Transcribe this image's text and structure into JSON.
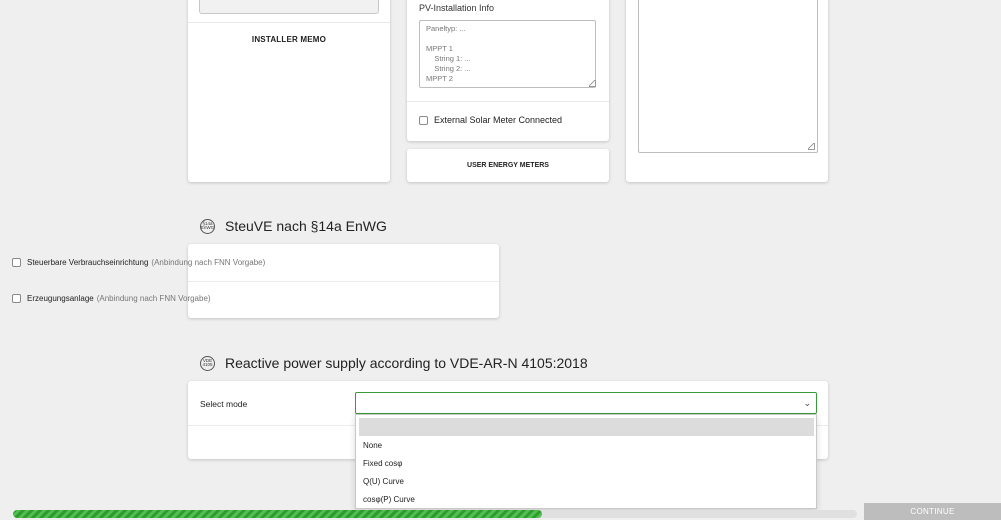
{
  "installer": {
    "memo_label": "INSTALLER MEMO"
  },
  "pv": {
    "title": "PV-Installation Info",
    "textarea_placeholder": "Paneltyp: ...\n\nMPPT 1\n    String 1: ...\n    String 2: ...\nMPPT 2",
    "external_meter_label": "External Solar Meter Connected"
  },
  "meters": {
    "button_label": "USER ENERGY METERS"
  },
  "steuve": {
    "badge": "§14a EnWG",
    "title": "SteuVE nach §14a EnWG",
    "rows": [
      {
        "label": "Steuerbare Verbrauchseinrichtung",
        "note": "(Anbindung nach FNN Vorgabe)"
      },
      {
        "label": "Erzeugungsanlage",
        "note": "(Anbindung nach FNN Vorgabe)"
      }
    ]
  },
  "vde": {
    "badge": "VDE 4105",
    "title": "Reactive power supply according to VDE-AR-N 4105:2018",
    "select_label": "Select mode",
    "select_value": "",
    "options": [
      "",
      "None",
      "Fixed cosφ",
      "Q(U) Curve",
      "cosφ(P) Curve"
    ]
  },
  "footer": {
    "progress_fraction": 0.627,
    "continue_label": "CONTINUE"
  },
  "colors": {
    "accent_green": "#3a9a3a",
    "progress_dark": "#2e9b2e",
    "progress_light": "#52be52",
    "button_disabled": "#bdbdbd"
  },
  "icons": {
    "chevron": "chevron-down-icon",
    "resize": "resize-handle-icon"
  }
}
